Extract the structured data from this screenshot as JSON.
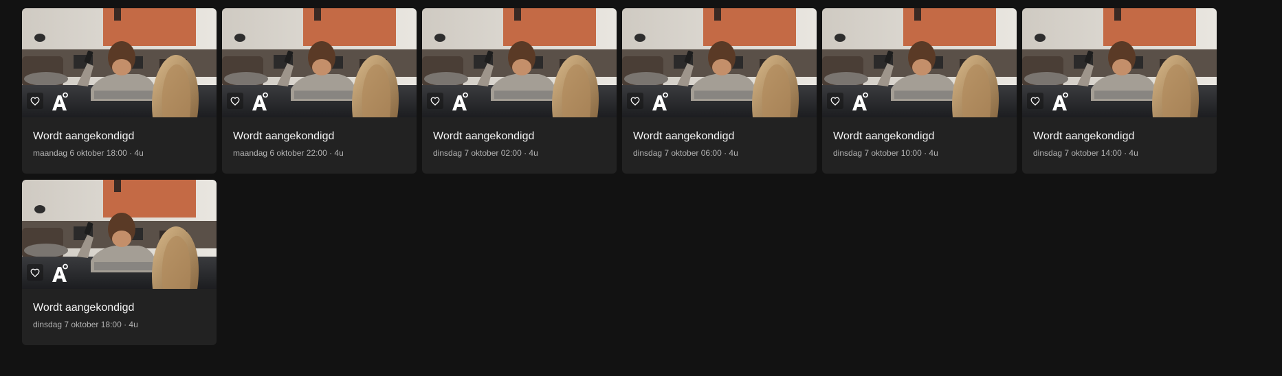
{
  "colors": {
    "background": "#121212",
    "card": "#222222",
    "title_text": "#f2f2f2",
    "meta_text": "#b3b3b3"
  },
  "icons": {
    "favorite": "heart-outline-icon",
    "channel": "channel-a-logo-icon"
  },
  "channel_logo": {
    "letter": "A"
  },
  "programs": [
    {
      "title": "Wordt aangekondigd",
      "meta": "maandag 6 oktober 18:00 · 4u"
    },
    {
      "title": "Wordt aangekondigd",
      "meta": "maandag 6 oktober 22:00 · 4u"
    },
    {
      "title": "Wordt aangekondigd",
      "meta": "dinsdag 7 oktober 02:00 · 4u"
    },
    {
      "title": "Wordt aangekondigd",
      "meta": "dinsdag 7 oktober 06:00 · 4u"
    },
    {
      "title": "Wordt aangekondigd",
      "meta": "dinsdag 7 oktober 10:00 · 4u"
    },
    {
      "title": "Wordt aangekondigd",
      "meta": "dinsdag 7 oktober 14:00 · 4u"
    },
    {
      "title": "Wordt aangekondigd",
      "meta": "dinsdag 7 oktober 18:00 · 4u"
    }
  ]
}
